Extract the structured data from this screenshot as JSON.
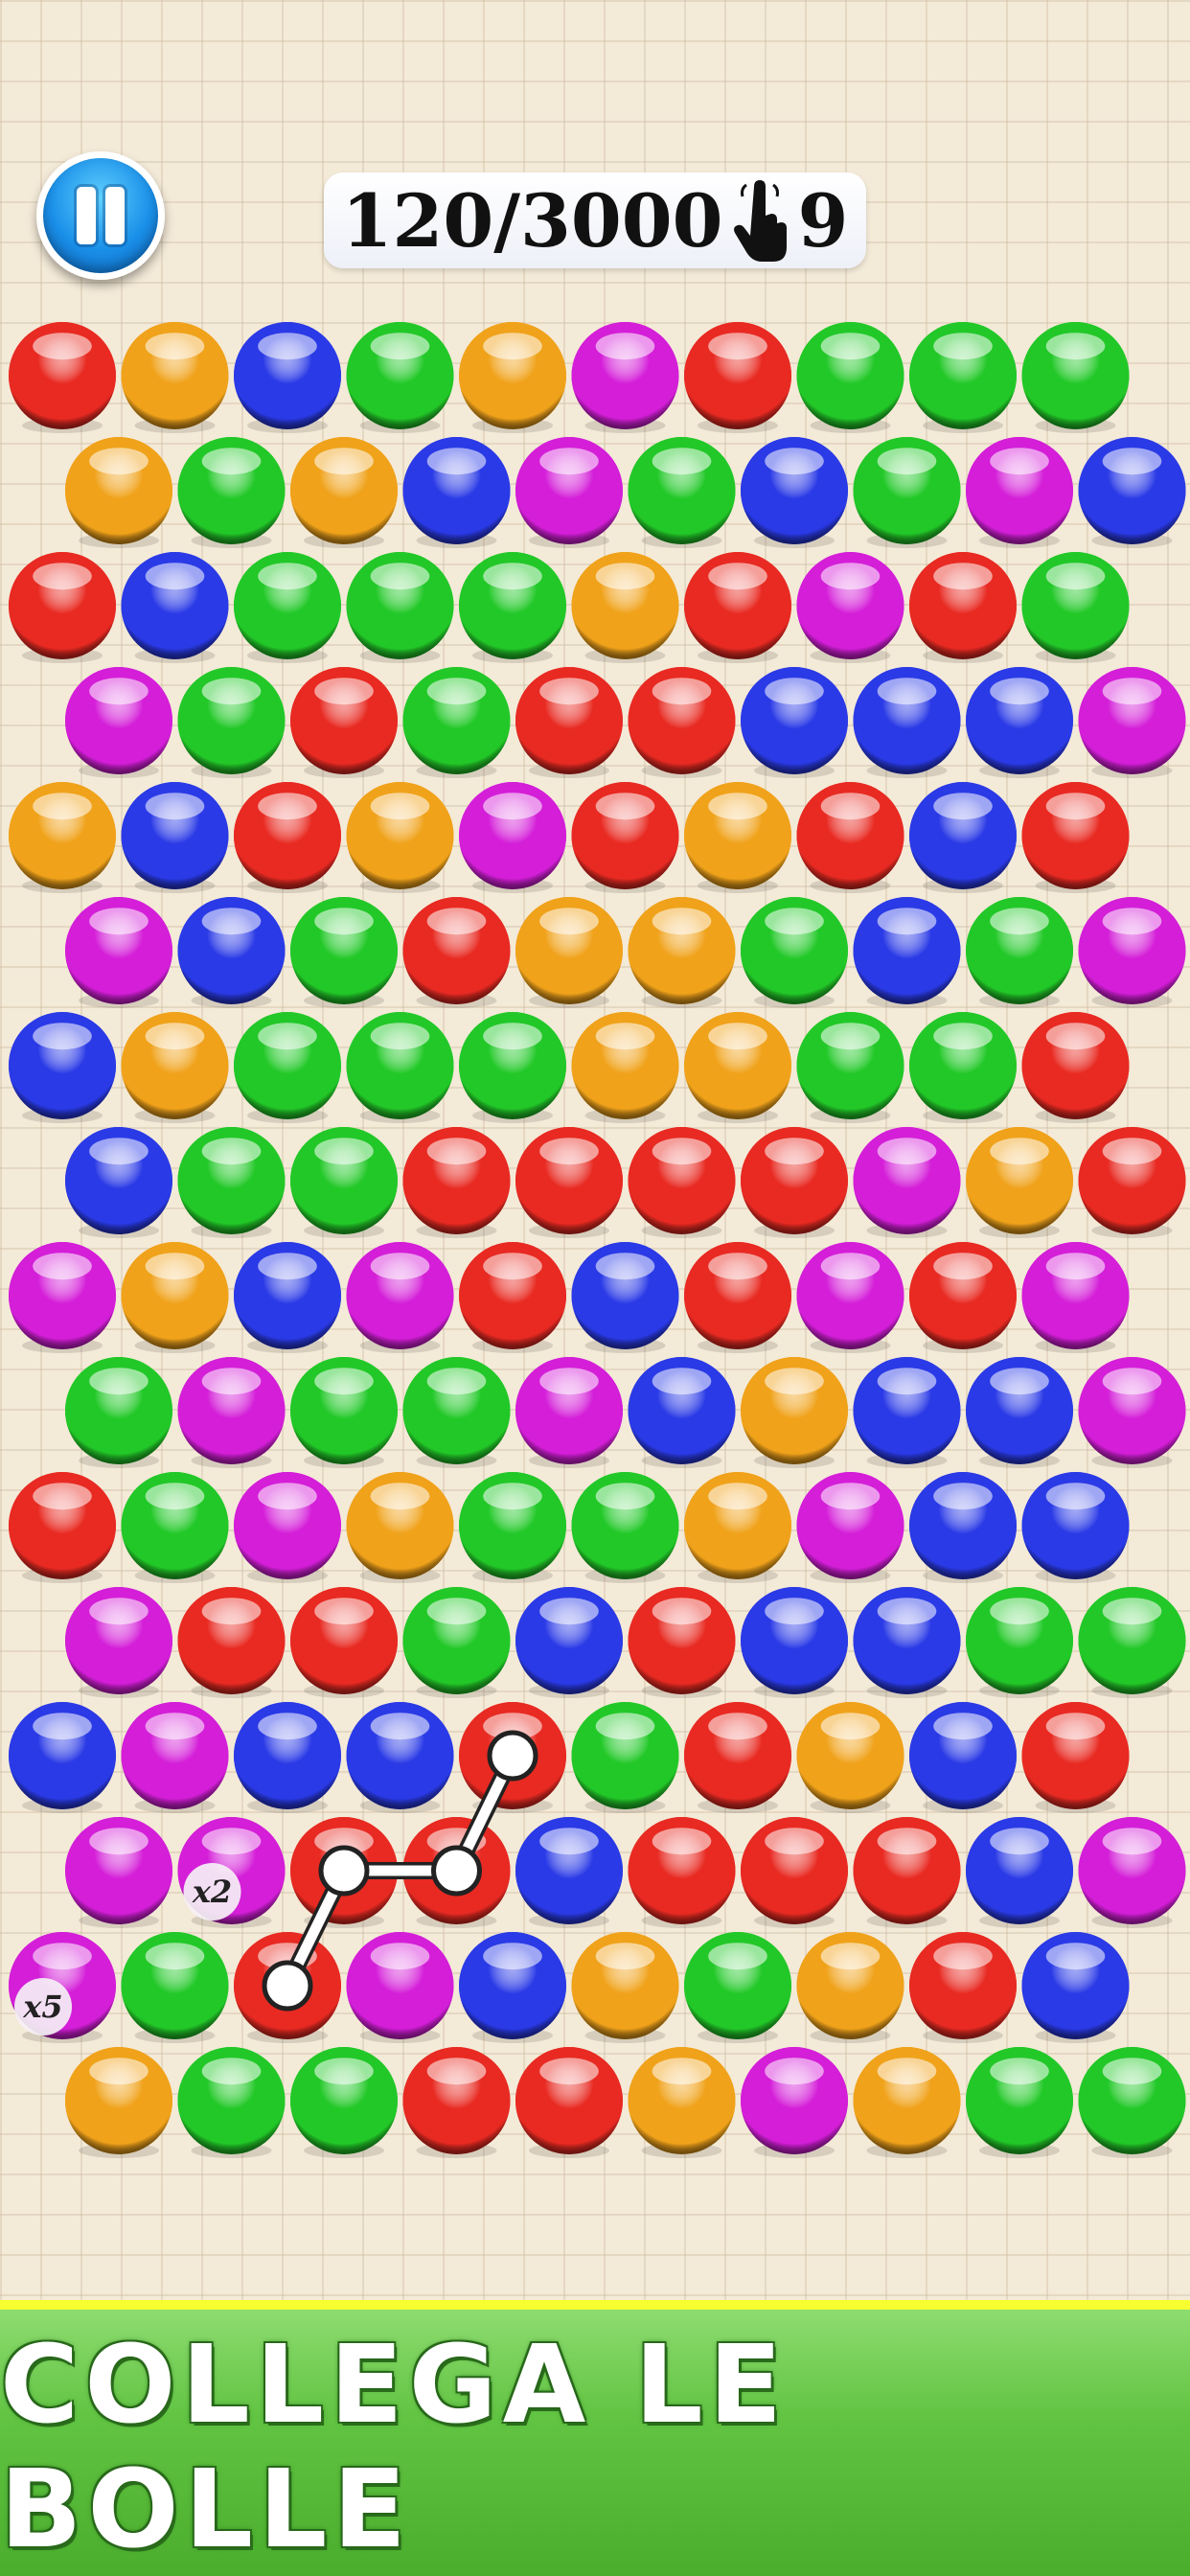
{
  "hud": {
    "pause_icon": "pause-icon",
    "score_text": "120/3000",
    "moves_icon": "hand-tap-icon",
    "moves_left": "9"
  },
  "colors": {
    "R": "#e82a22",
    "O": "#f0a21a",
    "B": "#2a3ae6",
    "G": "#22c828",
    "M": "#d41ed8"
  },
  "board": {
    "rows": [
      [
        "R",
        "O",
        "B",
        "G",
        "O",
        "M",
        "R",
        "G",
        "G",
        "G"
      ],
      [
        "O",
        "G",
        "O",
        "B",
        "M",
        "G",
        "B",
        "G",
        "M",
        "B"
      ],
      [
        "R",
        "B",
        "G",
        "G",
        "G",
        "O",
        "R",
        "M",
        "R",
        "G"
      ],
      [
        "M",
        "G",
        "R",
        "G",
        "R",
        "R",
        "B",
        "B",
        "B",
        "M"
      ],
      [
        "O",
        "B",
        "R",
        "O",
        "M",
        "R",
        "O",
        "R",
        "B",
        "R"
      ],
      [
        "M",
        "B",
        "G",
        "R",
        "O",
        "O",
        "G",
        "B",
        "G",
        "M"
      ],
      [
        "B",
        "O",
        "G",
        "G",
        "G",
        "O",
        "O",
        "G",
        "G",
        "R"
      ],
      [
        "B",
        "G",
        "G",
        "R",
        "R",
        "R",
        "R",
        "M",
        "O",
        "R"
      ],
      [
        "M",
        "O",
        "B",
        "M",
        "R",
        "B",
        "R",
        "M",
        "R",
        "M"
      ],
      [
        "G",
        "M",
        "G",
        "G",
        "M",
        "B",
        "O",
        "B",
        "B",
        "M"
      ],
      [
        "R",
        "G",
        "M",
        "O",
        "G",
        "G",
        "O",
        "M",
        "B",
        "B"
      ],
      [
        "M",
        "R",
        "R",
        "G",
        "B",
        "R",
        "B",
        "B",
        "G",
        "G"
      ],
      [
        "B",
        "M",
        "B",
        "B",
        "R",
        "G",
        "R",
        "O",
        "B",
        "R"
      ],
      [
        "M",
        "M",
        "R",
        "R",
        "B",
        "R",
        "R",
        "R",
        "B",
        "M"
      ],
      [
        "M",
        "G",
        "R",
        "M",
        "B",
        "O",
        "G",
        "O",
        "R",
        "B"
      ],
      [
        "O",
        "G",
        "G",
        "R",
        "R",
        "O",
        "M",
        "O",
        "G",
        "G"
      ]
    ],
    "multipliers": [
      {
        "row": 13,
        "col": 1,
        "label": "x2"
      },
      {
        "row": 14,
        "col": 0,
        "label": "x5"
      }
    ],
    "selection_path": [
      {
        "row": 12,
        "col": 4
      },
      {
        "row": 13,
        "col": 3
      },
      {
        "row": 13,
        "col": 2
      },
      {
        "row": 14,
        "col": 2
      }
    ]
  },
  "footer": {
    "title": "COLLEGA LE BOLLE"
  }
}
